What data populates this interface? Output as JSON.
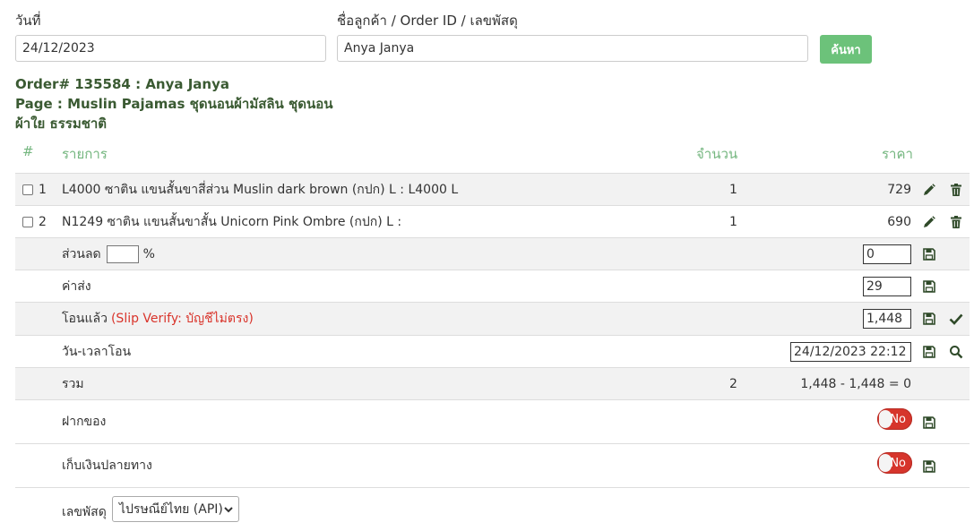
{
  "filters": {
    "date_label": "วันที่",
    "date_value": "24/12/2023",
    "customer_label": "ชื่อลูกค้า / Order ID / เลขพัสดุ",
    "customer_value": "Anya Janya",
    "search_button": "ค้นหา"
  },
  "order": {
    "title": "Order# 135584 : Anya Janya",
    "page": "Page : Muslin Pajamas ชุดนอนผ้ามัสลิน ชุดนอนผ้าใย ธรรมชาติ"
  },
  "table": {
    "headers": {
      "num": "#",
      "item": "รายการ",
      "qty": "จำนวน",
      "price": "ราคา"
    },
    "items": [
      {
        "num": "1",
        "name": "L4000 ซาติน แขนสั้นขาสี่ส่วน Muslin dark brown (กปก) L : L4000 L",
        "qty": "1",
        "price": "729"
      },
      {
        "num": "2",
        "name": "N1249 ซาติน แขนสั้นขาสั้น Unicorn Pink Ombre (กปก) L :",
        "qty": "1",
        "price": "690"
      }
    ],
    "discount": {
      "label": "ส่วนลด",
      "percent_value": "",
      "percent_sign": "%",
      "value": "0"
    },
    "shipping": {
      "label": "ค่าส่ง",
      "value": "29"
    },
    "transferred": {
      "label": "โอนแล้ว",
      "warning": "(Slip Verify: บัญชีไม่ตรง)",
      "value": "1,448"
    },
    "transfer_time": {
      "label": "วัน-เวลาโอน",
      "value": "24/12/2023 22:12"
    },
    "total": {
      "label": "รวม",
      "qty": "2",
      "value": "1,448 - 1,448 = 0"
    },
    "deposit": {
      "label": "ฝากของ",
      "toggle": "No"
    },
    "cod": {
      "label": "เก็บเงินปลายทาง",
      "toggle": "No"
    },
    "tracking": {
      "label": "เลขพัสดุ",
      "selected": "ไปรษณีย์ไทย (API)"
    }
  },
  "colors": {
    "accent_green": "#6cc27a",
    "header_green": "#74b67f",
    "title_green": "#3a5a32",
    "toggle_red": "#d6352c",
    "warning_red": "#d9342b",
    "icon_dark": "#2f4a29"
  },
  "icons": [
    "pencil-icon",
    "trash-icon",
    "save-icon",
    "check-icon",
    "search-icon",
    "chevron-down-icon"
  ]
}
